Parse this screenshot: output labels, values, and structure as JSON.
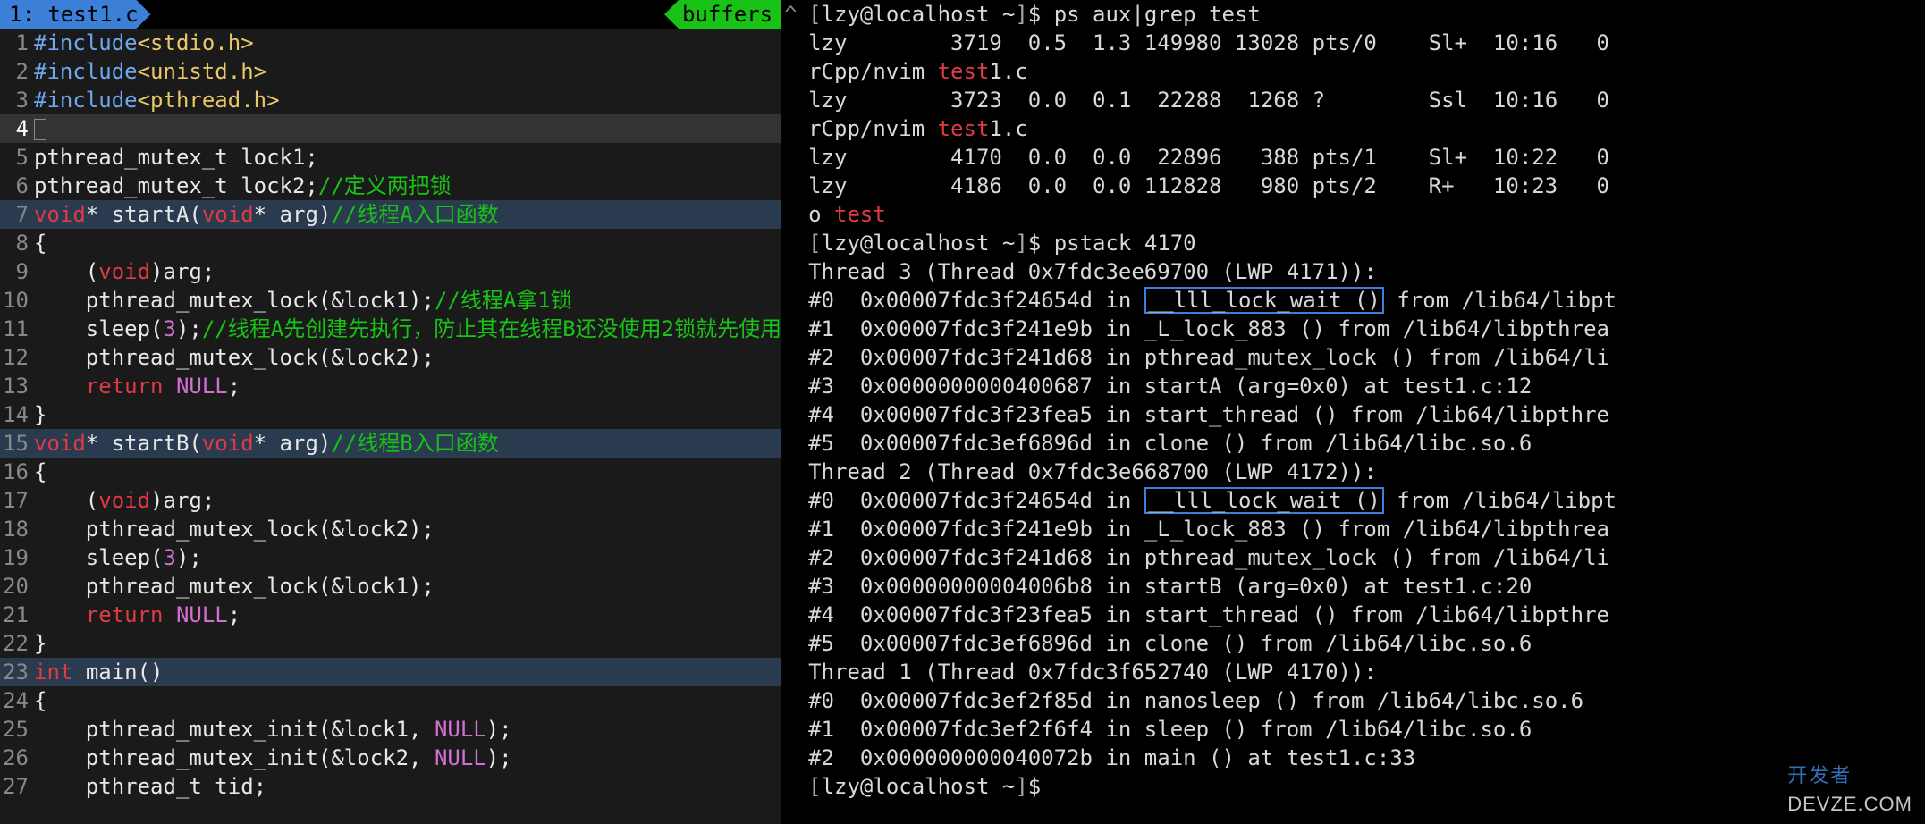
{
  "tab": {
    "label": "1: test1.c"
  },
  "buffers_label": "buffers",
  "code": [
    {
      "n": "1",
      "cls": "",
      "spans": [
        [
          "inc",
          "#include"
        ],
        [
          "str",
          "<stdio.h>"
        ]
      ]
    },
    {
      "n": "2",
      "cls": "",
      "spans": [
        [
          "inc",
          "#include"
        ],
        [
          "str",
          "<unistd.h>"
        ]
      ]
    },
    {
      "n": "3",
      "cls": "",
      "spans": [
        [
          "inc",
          "#include"
        ],
        [
          "str",
          "<pthread.h>"
        ]
      ]
    },
    {
      "n": "4",
      "cls": "cur",
      "spans": [
        [
          "cursor",
          ""
        ]
      ]
    },
    {
      "n": "5",
      "cls": "",
      "spans": [
        [
          "txt-white",
          "pthread_mutex_t lock1;"
        ]
      ]
    },
    {
      "n": "6",
      "cls": "",
      "spans": [
        [
          "txt-white",
          "pthread_mutex_t lock2;"
        ],
        [
          "cmt",
          "//定义两把锁"
        ]
      ]
    },
    {
      "n": "7",
      "cls": "sec",
      "spans": [
        [
          "kw",
          "void"
        ],
        [
          "paren",
          "* "
        ],
        [
          "fn",
          "startA"
        ],
        [
          "paren",
          "("
        ],
        [
          "kw",
          "void"
        ],
        [
          "paren",
          "* arg)"
        ],
        [
          "cmt",
          "//线程A入口函数"
        ]
      ]
    },
    {
      "n": "8",
      "cls": "",
      "spans": [
        [
          "paren",
          "{"
        ]
      ]
    },
    {
      "n": "9",
      "cls": "",
      "spans": [
        [
          "paren",
          "    ("
        ],
        [
          "kw",
          "void"
        ],
        [
          "paren",
          ")arg;"
        ]
      ]
    },
    {
      "n": "10",
      "cls": "",
      "spans": [
        [
          "paren",
          "    "
        ],
        [
          "fn",
          "pthread_mutex_lock"
        ],
        [
          "paren",
          "(&lock1);"
        ],
        [
          "cmt",
          "//线程A拿1锁"
        ]
      ]
    },
    {
      "n": "11",
      "cls": "",
      "spans": [
        [
          "paren",
          "    "
        ],
        [
          "fn",
          "sleep"
        ],
        [
          "paren",
          "("
        ],
        [
          "num",
          "3"
        ],
        [
          "paren",
          ");"
        ],
        [
          "cmt",
          "//线程A先创建先执行，防止其在线程B还没使用2锁就先使用"
        ]
      ]
    },
    {
      "n": "12",
      "cls": "",
      "spans": [
        [
          "paren",
          "    "
        ],
        [
          "fn",
          "pthread_mutex_lock"
        ],
        [
          "paren",
          "(&lock2);"
        ]
      ]
    },
    {
      "n": "13",
      "cls": "",
      "spans": [
        [
          "paren",
          "    "
        ],
        [
          "kw",
          "return"
        ],
        [
          "paren",
          " "
        ],
        [
          "num",
          "NULL"
        ],
        [
          "paren",
          ";"
        ]
      ]
    },
    {
      "n": "14",
      "cls": "",
      "spans": [
        [
          "paren",
          "}"
        ]
      ]
    },
    {
      "n": "15",
      "cls": "sec",
      "spans": [
        [
          "kw",
          "void"
        ],
        [
          "paren",
          "* "
        ],
        [
          "fn",
          "startB"
        ],
        [
          "paren",
          "("
        ],
        [
          "kw",
          "void"
        ],
        [
          "paren",
          "* arg)"
        ],
        [
          "cmt",
          "//线程B入口函数"
        ]
      ]
    },
    {
      "n": "16",
      "cls": "",
      "spans": [
        [
          "paren",
          "{"
        ]
      ]
    },
    {
      "n": "17",
      "cls": "",
      "spans": [
        [
          "paren",
          "    ("
        ],
        [
          "kw",
          "void"
        ],
        [
          "paren",
          ")arg;"
        ]
      ]
    },
    {
      "n": "18",
      "cls": "",
      "spans": [
        [
          "paren",
          "    "
        ],
        [
          "fn",
          "pthread_mutex_lock"
        ],
        [
          "paren",
          "(&lock2);"
        ]
      ]
    },
    {
      "n": "19",
      "cls": "",
      "spans": [
        [
          "paren",
          "    "
        ],
        [
          "fn",
          "sleep"
        ],
        [
          "paren",
          "("
        ],
        [
          "num",
          "3"
        ],
        [
          "paren",
          ");"
        ]
      ]
    },
    {
      "n": "20",
      "cls": "",
      "spans": [
        [
          "paren",
          "    "
        ],
        [
          "fn",
          "pthread_mutex_lock"
        ],
        [
          "paren",
          "(&lock1);"
        ]
      ]
    },
    {
      "n": "21",
      "cls": "",
      "spans": [
        [
          "paren",
          "    "
        ],
        [
          "kw",
          "return"
        ],
        [
          "paren",
          " "
        ],
        [
          "num",
          "NULL"
        ],
        [
          "paren",
          ";"
        ]
      ]
    },
    {
      "n": "22",
      "cls": "",
      "spans": [
        [
          "paren",
          "}"
        ]
      ]
    },
    {
      "n": "23",
      "cls": "sec",
      "spans": [
        [
          "kw",
          "int"
        ],
        [
          "paren",
          " "
        ],
        [
          "fn",
          "main"
        ],
        [
          "paren",
          "()"
        ]
      ]
    },
    {
      "n": "24",
      "cls": "",
      "spans": [
        [
          "paren",
          "{"
        ]
      ]
    },
    {
      "n": "25",
      "cls": "",
      "spans": [
        [
          "paren",
          "    "
        ],
        [
          "fn",
          "pthread_mutex_init"
        ],
        [
          "paren",
          "(&lock1, "
        ],
        [
          "num",
          "NULL"
        ],
        [
          "paren",
          ");"
        ]
      ]
    },
    {
      "n": "26",
      "cls": "",
      "spans": [
        [
          "paren",
          "    "
        ],
        [
          "fn",
          "pthread_mutex_init"
        ],
        [
          "paren",
          "(&lock2, "
        ],
        [
          "num",
          "NULL"
        ],
        [
          "paren",
          ");"
        ]
      ]
    },
    {
      "n": "27",
      "cls": "",
      "spans": [
        [
          "paren",
          "    pthread_t tid;"
        ]
      ]
    }
  ],
  "term": [
    {
      "t": "prompt",
      "cmd": "ps aux|grep test"
    },
    {
      "t": "plain",
      "text": "lzy        3719  0.5  1.3 149980 13028 pts/0    Sl+  10:16   0"
    },
    {
      "t": "cont",
      "pre": "rCpp/nvim ",
      "kw": "test",
      "post": "1.c"
    },
    {
      "t": "plain",
      "text": "lzy        3723  0.0  0.1  22288  1268 ?        Ssl  10:16   0"
    },
    {
      "t": "cont",
      "pre": "rCpp/nvim ",
      "kw": "test",
      "post": "1.c"
    },
    {
      "t": "plain",
      "text": "lzy        4170  0.0  0.0  22896   388 pts/1    Sl+  10:22   0"
    },
    {
      "t": "plain",
      "text": "lzy        4186  0.0  0.0 112828   980 pts/2    R+   10:23   0"
    },
    {
      "t": "cont",
      "pre": "o ",
      "kw": "test",
      "post": ""
    },
    {
      "t": "prompt",
      "cmd": "pstack 4170"
    },
    {
      "t": "plain",
      "text": "Thread 3 (Thread 0x7fdc3ee69700 (LWP 4171)):"
    },
    {
      "t": "box",
      "pre": "#0  0x00007fdc3f24654d in ",
      "box": "__lll_lock_wait ()",
      "post": " from /lib64/libpt"
    },
    {
      "t": "plain",
      "text": "#1  0x00007fdc3f241e9b in _L_lock_883 () from /lib64/libpthrea"
    },
    {
      "t": "plain",
      "text": "#2  0x00007fdc3f241d68 in pthread_mutex_lock () from /lib64/li"
    },
    {
      "t": "plain",
      "text": "#3  0x0000000000400687 in startA (arg=0x0) at test1.c:12"
    },
    {
      "t": "plain",
      "text": "#4  0x00007fdc3f23fea5 in start_thread () from /lib64/libpthre"
    },
    {
      "t": "plain",
      "text": "#5  0x00007fdc3ef6896d in clone () from /lib64/libc.so.6"
    },
    {
      "t": "plain",
      "text": "Thread 2 (Thread 0x7fdc3e668700 (LWP 4172)):"
    },
    {
      "t": "box",
      "pre": "#0  0x00007fdc3f24654d in ",
      "box": "__lll_lock_wait ()",
      "post": " from /lib64/libpt"
    },
    {
      "t": "plain",
      "text": "#1  0x00007fdc3f241e9b in _L_lock_883 () from /lib64/libpthrea"
    },
    {
      "t": "plain",
      "text": "#2  0x00007fdc3f241d68 in pthread_mutex_lock () from /lib64/li"
    },
    {
      "t": "plain",
      "text": "#3  0x00000000004006b8 in startB (arg=0x0) at test1.c:20"
    },
    {
      "t": "plain",
      "text": "#4  0x00007fdc3f23fea5 in start_thread () from /lib64/libpthre"
    },
    {
      "t": "plain",
      "text": "#5  0x00007fdc3ef6896d in clone () from /lib64/libc.so.6"
    },
    {
      "t": "plain",
      "text": "Thread 1 (Thread 0x7fdc3f652740 (LWP 4170)):"
    },
    {
      "t": "plain",
      "text": "#0  0x00007fdc3ef2f85d in nanosleep () from /lib64/libc.so.6"
    },
    {
      "t": "plain",
      "text": "#1  0x00007fdc3ef2f6f4 in sleep () from /lib64/libc.so.6"
    },
    {
      "t": "plain",
      "text": "#2  0x000000000040072b in main () at test1.c:33"
    },
    {
      "t": "prompt",
      "cmd": ""
    }
  ],
  "prompt": {
    "user": "lzy",
    "at": "@",
    "host": "localhost",
    "path": "~",
    "dollar": "$"
  },
  "watermark": {
    "brand": "开发者",
    "dom": "DEVZE.COM"
  },
  "scrollbar_glyph": "^"
}
